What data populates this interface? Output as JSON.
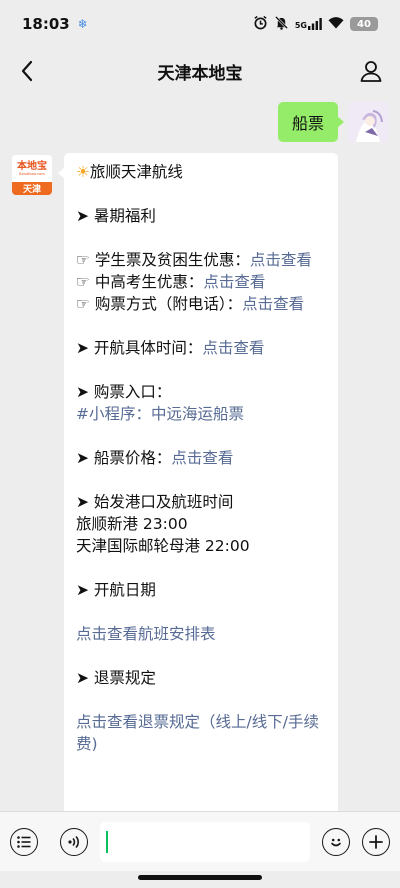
{
  "status_bar": {
    "time": "18:03",
    "network_label": "5G",
    "battery": "40"
  },
  "header": {
    "title": "天津本地宝"
  },
  "user_message": {
    "text": "船票"
  },
  "bot_avatar": {
    "logo_text": "本地宝",
    "logo_sub": "Bendibao.com",
    "city": "天津"
  },
  "message": {
    "title": "旅顺天津航线",
    "welfare": "➤ 暑期福利",
    "student_label": "☞ 学生票及贫困生优惠：",
    "student_link": "点击查看",
    "exam_label": "☞ 中高考生优惠：",
    "exam_link": "点击查看",
    "purchase_method_label": "☞ 购票方式（附电话）：",
    "purchase_method_link": "点击查看",
    "sail_time_label": "➤ 开航具体时间：",
    "sail_time_link": "点击查看",
    "entry_label": "➤ 购票入口：",
    "entry_link": "#小程序：中远海运船票",
    "price_label": "➤ 船票价格：",
    "price_link": "点击查看",
    "ports_label": "➤ 始发港口及航班时间",
    "port_1": "旅顺新港 23:00",
    "port_2": "天津国际邮轮母港 22:00",
    "dates_label": "➤ 开航日期",
    "schedule_link": "点击查看航班安排表",
    "refund_label": "➤ 退票规定",
    "refund_link": "点击查看退票规定（线上/线下/手续费)"
  },
  "colors": {
    "link": "#576b95",
    "user_bubble": "#95ec69",
    "cursor": "#07c160",
    "logo_orange": "#ee6a1f"
  }
}
